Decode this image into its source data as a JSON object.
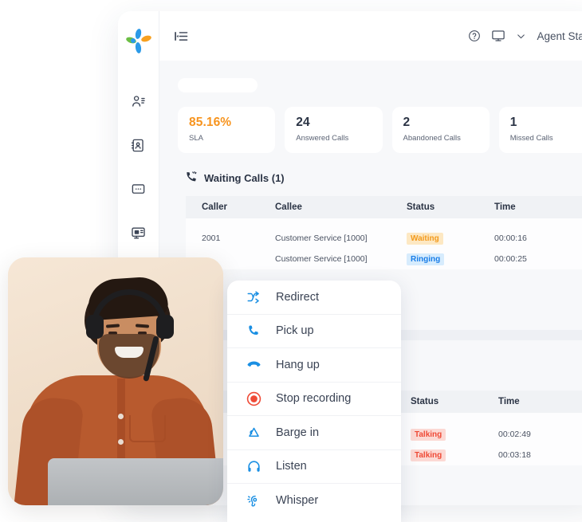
{
  "app": {
    "logo_name": "pinwheel-logo",
    "logo_colors": [
      "#2b9ae8",
      "#f7a020",
      "#6cbe45"
    ]
  },
  "topbar": {
    "collapse_icon": "sidebar-collapse-icon",
    "help_icon": "help-circle-icon",
    "monitor_icon": "monitor-icon",
    "chevron_icon": "chevron-down-icon",
    "agent_status_label": "Agent Statu"
  },
  "sidebar": {
    "items": [
      {
        "icon": "contacts-icon",
        "active": false
      },
      {
        "icon": "address-book-icon",
        "active": false
      },
      {
        "icon": "chat-bubble-icon",
        "active": false
      },
      {
        "icon": "desk-monitor-icon",
        "active": false
      },
      {
        "icon": "monitor-list-icon",
        "active": false
      },
      {
        "icon": "headset-icon",
        "active": true
      }
    ]
  },
  "stats": {
    "cards": [
      {
        "value": "85.16%",
        "label": "SLA",
        "accent": "#f7941e"
      },
      {
        "value": "24",
        "label": "Answered Calls",
        "accent": "#2b3445"
      },
      {
        "value": "2",
        "label": "Abandoned Calls",
        "accent": "#2b3445"
      },
      {
        "value": "1",
        "label": "Missed Calls",
        "accent": "#2b3445"
      }
    ]
  },
  "waiting_calls": {
    "icon": "phone-waiting-icon",
    "title": "Waiting Calls (1)",
    "columns": [
      "Caller",
      "Callee",
      "Status",
      "Time"
    ],
    "rows": [
      {
        "caller": "2001",
        "callee": "Customer Service [1000]",
        "status": "Waiting",
        "status_type": "waiting",
        "time": "00:00:16"
      },
      {
        "caller": "",
        "callee": "Customer Service [1000]",
        "status": "Ringing",
        "status_type": "ringing",
        "time": "00:00:25"
      }
    ]
  },
  "active_calls": {
    "columns": [
      "Status",
      "Time"
    ],
    "rows": [
      {
        "status": "Talking",
        "status_type": "talking",
        "time": "00:02:49"
      },
      {
        "status": "Talking",
        "status_type": "talking",
        "time": "00:03:18"
      }
    ]
  },
  "context_menu": {
    "items": [
      {
        "label": "Redirect",
        "icon": "shuffle-icon",
        "color": "#1a8fe3"
      },
      {
        "label": "Pick up",
        "icon": "phone-icon",
        "color": "#1a8fe3"
      },
      {
        "label": "Hang up",
        "icon": "phone-hangup-icon",
        "color": "#1a8fe3"
      },
      {
        "label": "Stop recording",
        "icon": "record-stop-icon",
        "color": "#ef4a36"
      },
      {
        "label": "Barge in",
        "icon": "barge-in-icon",
        "color": "#1a8fe3"
      },
      {
        "label": "Listen",
        "icon": "headphones-icon",
        "color": "#1a8fe3"
      },
      {
        "label": "Whisper",
        "icon": "whisper-ear-icon",
        "color": "#1a8fe3"
      }
    ]
  },
  "photo": {
    "alt": "smiling-agent-with-headset-at-laptop"
  }
}
